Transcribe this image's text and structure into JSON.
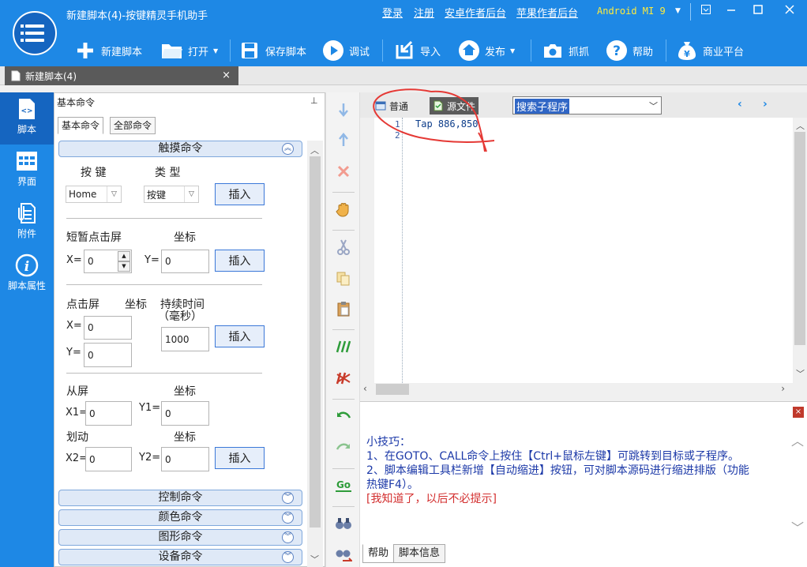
{
  "window": {
    "title": "新建脚本(4)-按键精灵手机助手",
    "links": [
      "登录",
      "注册",
      "安卓作者后台",
      "苹果作者后台"
    ],
    "device": "Android  MI 9",
    "device_arrow": "▼"
  },
  "toolbar": {
    "new": "新建脚本",
    "open": "打开",
    "save": "保存脚本",
    "debug": "调试",
    "import": "导入",
    "publish": "发布",
    "capture": "抓抓",
    "help": "帮助",
    "market": "商业平台"
  },
  "doc_tab": {
    "label": "新建脚本(4)",
    "close": "×"
  },
  "sidebar": {
    "items": [
      "脚本",
      "界面",
      "附件",
      "脚本属性"
    ]
  },
  "panel": {
    "title": "基本命令",
    "pin": "⊥",
    "tabs": [
      "基本命令",
      "全部命令"
    ],
    "groups": {
      "touch": "触摸命令",
      "control": "控制命令",
      "color": "颜色命令",
      "graphics": "图形命令",
      "device": "设备命令"
    },
    "key": {
      "label_key": "按 键",
      "label_type": "类 型",
      "key_value": "Home",
      "type_value": "按键",
      "insert": "插入"
    },
    "tap": {
      "label": "短暂点击屏",
      "coord": "坐标",
      "x_label": "X=",
      "x": "0",
      "y_label": "Y=",
      "y": "0",
      "insert": "插入"
    },
    "press": {
      "label": "点击屏",
      "coord": "坐标",
      "duration": "持续时间",
      "unit": "（毫秒）",
      "x_label": "X=",
      "x": "0",
      "y_label": "Y=",
      "y": "0",
      "ms": "1000",
      "insert": "插入"
    },
    "swipe": {
      "from": "从屏",
      "coord": "坐标",
      "x1_label": "X1=",
      "x1": "0",
      "y1_label": "Y1=",
      "y1": "0",
      "action": "划动",
      "coord2": "坐标",
      "x2_label": "X2=",
      "x2": "0",
      "y2_label": "Y2=",
      "y2": "0",
      "insert": "插入"
    }
  },
  "editor": {
    "modes": [
      "普通",
      "源文件"
    ],
    "search_placeholder": "搜索子程序",
    "nav_prev": "‹",
    "nav_next": "›",
    "lines": [
      {
        "num": "1",
        "text": "Tap 886,850"
      },
      {
        "num": "2",
        "text": ""
      }
    ]
  },
  "tips": {
    "title": "小技巧：",
    "line1": "1、在GOTO、CALL命令上按住【Ctrl+鼠标左键】可跳转到目标或子程序。",
    "line2a": "2、脚本编辑工具栏新增【自动缩进】按钮，可对脚本源码进行缩进排版（功能",
    "line2b": "热键F4）。",
    "dismiss": "[我知道了，以后不必提示]",
    "close": "×"
  },
  "bottom_tabs": [
    "帮助",
    "脚本信息"
  ],
  "colors": {
    "accent": "#1e88e5",
    "annotation": "#e53935"
  }
}
